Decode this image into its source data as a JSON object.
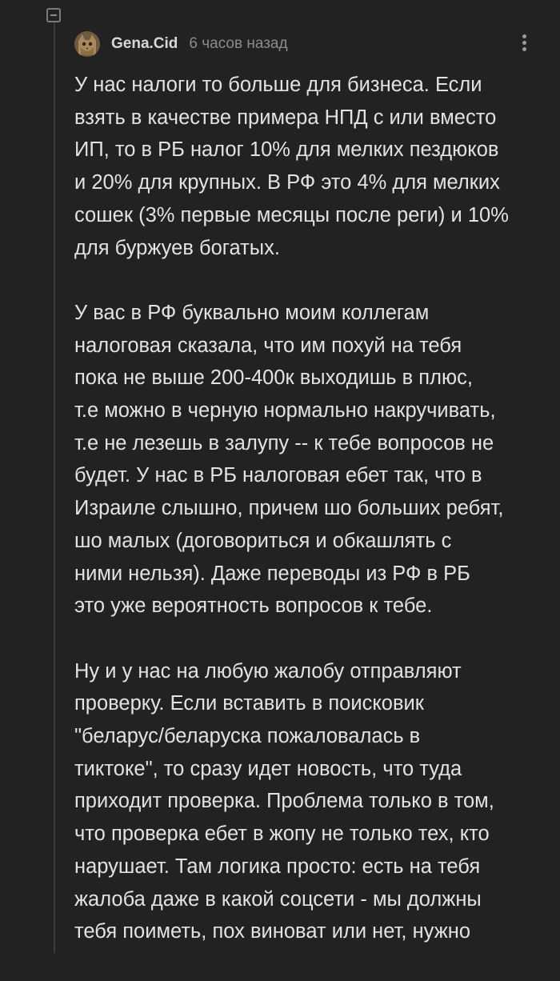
{
  "comment": {
    "author": "Gena.Cid",
    "timestamp": "6 часов назад",
    "avatar_icon": "cat-avatar",
    "paragraphs": [
      "У нас налоги то больше для бизнеса. Если\nвзять в качестве примера НПД с или вместо\nИП, то в РБ налог 10% для мелких пездюков\nи 20% для крупных. В РФ это 4% для мелких\nсошек (3% первые месяцы после реги) и 10%\nдля буржуев богатых.",
      "У вас в РФ буквально моим коллегам\nналоговая сказала, что им похуй на тебя\nпока не выше 200-400к выходишь в плюс,\nт.е можно в черную нормально накручивать,\nт.е не лезешь в залупу -- к тебе вопросов не\nбудет. У нас в РБ налоговая ебет так, что в\nИзраиле слышно, причем шо больших ребят,\nшо малых (договориться и обкашлять с\nними нельзя). Даже переводы из РФ в РБ\nэто уже вероятность вопросов к тебе.",
      "Ну и у нас на любую жалобу отправляют\nпроверку. Если вставить в поисковик\n\"беларус/беларуска пожаловалась в\nтиктоке\", то сразу идет новость, что туда\nприходит проверка. Проблема только в том,\nчто проверка ебет в жопу не только тех, кто\nнарушает. Там логика просто: есть на тебя\nжалоба даже в какой соцсети - мы должны\nтебя поиметь, пох виноват или нет, нужно"
    ]
  },
  "colors": {
    "background": "#222222",
    "text": "#e2e2e2",
    "muted": "#8c8c8c",
    "thread_line": "#3a3a3a"
  },
  "icons": {
    "collapse": "collapse-toggle-icon",
    "menu": "more-vertical-icon"
  }
}
